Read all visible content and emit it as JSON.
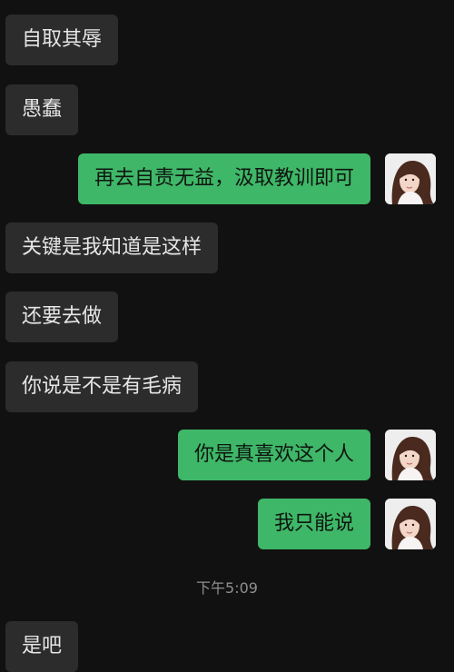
{
  "messages": [
    {
      "side": "in",
      "text": "自取其辱"
    },
    {
      "side": "in",
      "text": "愚蠢"
    },
    {
      "side": "out",
      "text": "再去自责无益，汲取教训即可"
    },
    {
      "side": "in",
      "text": "关键是我知道是这样"
    },
    {
      "side": "in",
      "text": "还要去做"
    },
    {
      "side": "in",
      "text": "你说是不是有毛病"
    },
    {
      "side": "out",
      "text": "你是真喜欢这个人"
    },
    {
      "side": "out",
      "text": "我只能说"
    },
    {
      "side": "in",
      "text": "是吧"
    }
  ],
  "timestamp": "下午5:09",
  "colors": {
    "background": "#111111",
    "incoming_bubble": "#2c2c2c",
    "outgoing_bubble": "#3fb768",
    "timestamp_text": "#8f8f8f"
  },
  "icons": {
    "avatar": "user-avatar-photo"
  }
}
